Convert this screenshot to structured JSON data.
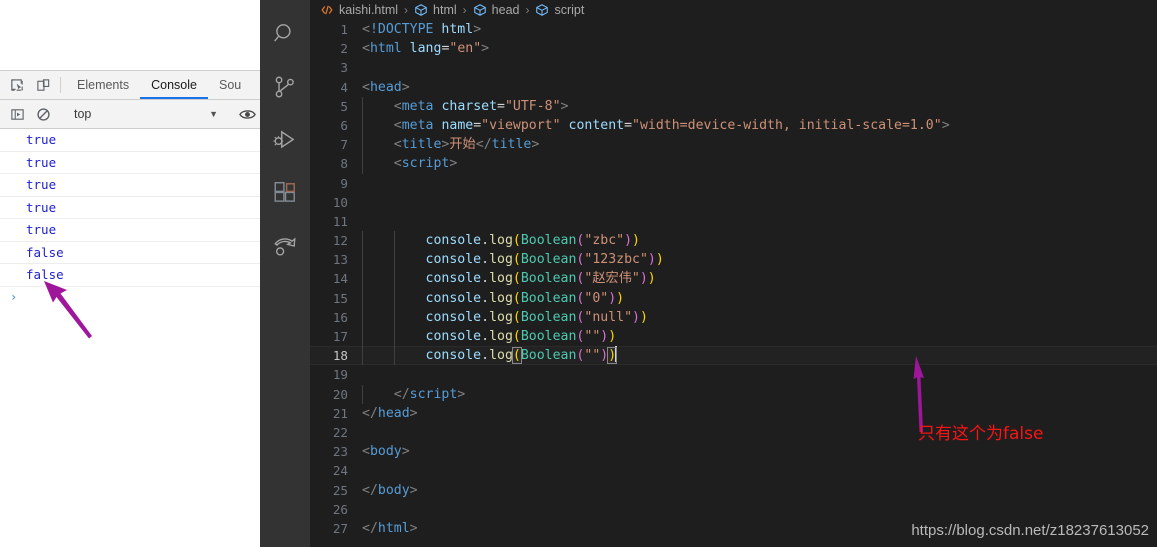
{
  "devtools": {
    "toolbar_icons": [
      {
        "name": "inspect-element-icon",
        "label": "Inspect"
      },
      {
        "name": "device-toolbar-icon",
        "label": "Toggle device toolbar"
      }
    ],
    "tabs": [
      {
        "label": "Elements",
        "active": false
      },
      {
        "label": "Console",
        "active": true
      },
      {
        "label": "Sou",
        "active": false
      }
    ],
    "filterbar": {
      "sidebar_toggle_label": "Show console sidebar",
      "clear_console_label": "Clear console",
      "context_value": "top",
      "caret": "▼",
      "eye_label": "Create live expression"
    },
    "console_entries": [
      {
        "value": "true"
      },
      {
        "value": "true"
      },
      {
        "value": "true"
      },
      {
        "value": "true"
      },
      {
        "value": "true"
      },
      {
        "value": "false"
      },
      {
        "value": "false"
      }
    ],
    "prompt_symbol": "›"
  },
  "activitybar": {
    "items": [
      {
        "name": "search-icon",
        "label": "Search"
      },
      {
        "name": "source-control-icon",
        "label": "Source Control"
      },
      {
        "name": "run-and-debug-icon",
        "label": "Run and Debug"
      },
      {
        "name": "extensions-icon",
        "label": "Extensions"
      },
      {
        "name": "remote-explorer-icon",
        "label": "Remote Explorer"
      }
    ]
  },
  "breadcrumb": {
    "separator": "›",
    "items": [
      {
        "label": "kaishi.html",
        "icon": "html-file-icon"
      },
      {
        "label": "html",
        "icon": "symbol-field-icon"
      },
      {
        "label": "head",
        "icon": "symbol-field-icon"
      },
      {
        "label": "script",
        "icon": "symbol-field-icon"
      }
    ]
  },
  "editor": {
    "active_line": 18,
    "lines": [
      {
        "n": 1,
        "tokens": [
          {
            "t": "tagb",
            "v": "<"
          },
          {
            "t": "tag",
            "v": "!DOCTYPE "
          },
          {
            "t": "attr",
            "v": "html"
          },
          {
            "t": "tagb",
            "v": ">"
          }
        ]
      },
      {
        "n": 2,
        "tokens": [
          {
            "t": "tagb",
            "v": "<"
          },
          {
            "t": "tag",
            "v": "html"
          },
          {
            "t": "plain",
            "v": " "
          },
          {
            "t": "attr",
            "v": "lang"
          },
          {
            "t": "eq",
            "v": "="
          },
          {
            "t": "str",
            "v": "\"en\""
          },
          {
            "t": "tagb",
            "v": ">"
          }
        ]
      },
      {
        "n": 3,
        "tokens": []
      },
      {
        "n": 4,
        "tokens": [
          {
            "t": "tagb",
            "v": "<"
          },
          {
            "t": "tag",
            "v": "head"
          },
          {
            "t": "tagb",
            "v": ">"
          }
        ]
      },
      {
        "n": 5,
        "tokens": [
          {
            "t": "plain",
            "v": "    "
          },
          {
            "t": "tagb",
            "v": "<"
          },
          {
            "t": "tag",
            "v": "meta"
          },
          {
            "t": "plain",
            "v": " "
          },
          {
            "t": "attr",
            "v": "charset"
          },
          {
            "t": "eq",
            "v": "="
          },
          {
            "t": "str",
            "v": "\"UTF-8\""
          },
          {
            "t": "tagb",
            "v": ">"
          }
        ]
      },
      {
        "n": 6,
        "tokens": [
          {
            "t": "plain",
            "v": "    "
          },
          {
            "t": "tagb",
            "v": "<"
          },
          {
            "t": "tag",
            "v": "meta"
          },
          {
            "t": "plain",
            "v": " "
          },
          {
            "t": "attr",
            "v": "name"
          },
          {
            "t": "eq",
            "v": "="
          },
          {
            "t": "str",
            "v": "\"viewport\""
          },
          {
            "t": "plain",
            "v": " "
          },
          {
            "t": "attr",
            "v": "content"
          },
          {
            "t": "eq",
            "v": "="
          },
          {
            "t": "str",
            "v": "\"width=device-width, initial-scale=1.0\""
          },
          {
            "t": "tagb",
            "v": ">"
          }
        ]
      },
      {
        "n": 7,
        "tokens": [
          {
            "t": "plain",
            "v": "    "
          },
          {
            "t": "tagb",
            "v": "<"
          },
          {
            "t": "tag",
            "v": "title"
          },
          {
            "t": "tagb",
            "v": ">"
          },
          {
            "t": "cjk",
            "v": "开始"
          },
          {
            "t": "tagb",
            "v": "</"
          },
          {
            "t": "tag",
            "v": "title"
          },
          {
            "t": "tagb",
            "v": ">"
          }
        ]
      },
      {
        "n": 8,
        "tokens": [
          {
            "t": "plain",
            "v": "    "
          },
          {
            "t": "tagb",
            "v": "<"
          },
          {
            "t": "tag",
            "v": "script"
          },
          {
            "t": "tagb",
            "v": ">"
          }
        ]
      },
      {
        "n": 9,
        "tokens": []
      },
      {
        "n": 10,
        "tokens": []
      },
      {
        "n": 11,
        "tokens": []
      },
      {
        "n": 12,
        "tokens": [
          {
            "t": "plain",
            "v": "        "
          },
          {
            "t": "obj",
            "v": "console"
          },
          {
            "t": "plain",
            "v": "."
          },
          {
            "t": "fn",
            "v": "log"
          },
          {
            "t": "p1",
            "v": "("
          },
          {
            "t": "class",
            "v": "Boolean"
          },
          {
            "t": "p2",
            "v": "("
          },
          {
            "t": "str",
            "v": "\"zbc\""
          },
          {
            "t": "p2",
            "v": ")"
          },
          {
            "t": "p1",
            "v": ")"
          }
        ]
      },
      {
        "n": 13,
        "tokens": [
          {
            "t": "plain",
            "v": "        "
          },
          {
            "t": "obj",
            "v": "console"
          },
          {
            "t": "plain",
            "v": "."
          },
          {
            "t": "fn",
            "v": "log"
          },
          {
            "t": "p1",
            "v": "("
          },
          {
            "t": "class",
            "v": "Boolean"
          },
          {
            "t": "p2",
            "v": "("
          },
          {
            "t": "str",
            "v": "\"123zbc\""
          },
          {
            "t": "p2",
            "v": ")"
          },
          {
            "t": "p1",
            "v": ")"
          }
        ]
      },
      {
        "n": 14,
        "tokens": [
          {
            "t": "plain",
            "v": "        "
          },
          {
            "t": "obj",
            "v": "console"
          },
          {
            "t": "plain",
            "v": "."
          },
          {
            "t": "fn",
            "v": "log"
          },
          {
            "t": "p1",
            "v": "("
          },
          {
            "t": "class",
            "v": "Boolean"
          },
          {
            "t": "p2",
            "v": "("
          },
          {
            "t": "str",
            "v": "\"赵宏伟\""
          },
          {
            "t": "p2",
            "v": ")"
          },
          {
            "t": "p1",
            "v": ")"
          }
        ]
      },
      {
        "n": 15,
        "tokens": [
          {
            "t": "plain",
            "v": "        "
          },
          {
            "t": "obj",
            "v": "console"
          },
          {
            "t": "plain",
            "v": "."
          },
          {
            "t": "fn",
            "v": "log"
          },
          {
            "t": "p1",
            "v": "("
          },
          {
            "t": "class",
            "v": "Boolean"
          },
          {
            "t": "p2",
            "v": "("
          },
          {
            "t": "str",
            "v": "\"0\""
          },
          {
            "t": "p2",
            "v": ")"
          },
          {
            "t": "p1",
            "v": ")"
          }
        ]
      },
      {
        "n": 16,
        "tokens": [
          {
            "t": "plain",
            "v": "        "
          },
          {
            "t": "obj",
            "v": "console"
          },
          {
            "t": "plain",
            "v": "."
          },
          {
            "t": "fn",
            "v": "log"
          },
          {
            "t": "p1",
            "v": "("
          },
          {
            "t": "class",
            "v": "Boolean"
          },
          {
            "t": "p2",
            "v": "("
          },
          {
            "t": "str",
            "v": "\"null\""
          },
          {
            "t": "p2",
            "v": ")"
          },
          {
            "t": "p1",
            "v": ")"
          }
        ]
      },
      {
        "n": 17,
        "tokens": [
          {
            "t": "plain",
            "v": "        "
          },
          {
            "t": "obj",
            "v": "console"
          },
          {
            "t": "plain",
            "v": "."
          },
          {
            "t": "fn",
            "v": "log"
          },
          {
            "t": "p1",
            "v": "("
          },
          {
            "t": "class",
            "v": "Boolean"
          },
          {
            "t": "p2",
            "v": "("
          },
          {
            "t": "str",
            "v": "\"\""
          },
          {
            "t": "p2",
            "v": ")"
          },
          {
            "t": "p1",
            "v": ")"
          }
        ]
      },
      {
        "n": 18,
        "tokens": [
          {
            "t": "plain",
            "v": "        "
          },
          {
            "t": "obj",
            "v": "console"
          },
          {
            "t": "plain",
            "v": "."
          },
          {
            "t": "fn",
            "v": "log"
          },
          {
            "t": "p1 bracket-match",
            "v": "("
          },
          {
            "t": "class",
            "v": "Boolean"
          },
          {
            "t": "p2",
            "v": "("
          },
          {
            "t": "str",
            "v": "\"\""
          },
          {
            "t": "p2",
            "v": ")"
          },
          {
            "t": "p1 bracket-match",
            "v": ")"
          },
          {
            "t": "cursor",
            "v": ""
          }
        ]
      },
      {
        "n": 19,
        "tokens": []
      },
      {
        "n": 20,
        "tokens": [
          {
            "t": "plain",
            "v": "    "
          },
          {
            "t": "tagb",
            "v": "</"
          },
          {
            "t": "tag",
            "v": "script"
          },
          {
            "t": "tagb",
            "v": ">"
          }
        ]
      },
      {
        "n": 21,
        "tokens": [
          {
            "t": "tagb",
            "v": "</"
          },
          {
            "t": "tag",
            "v": "head"
          },
          {
            "t": "tagb",
            "v": ">"
          }
        ]
      },
      {
        "n": 22,
        "tokens": []
      },
      {
        "n": 23,
        "tokens": [
          {
            "t": "tagb",
            "v": "<"
          },
          {
            "t": "tag",
            "v": "body"
          },
          {
            "t": "tagb",
            "v": ">"
          }
        ]
      },
      {
        "n": 24,
        "tokens": []
      },
      {
        "n": 25,
        "tokens": [
          {
            "t": "tagb",
            "v": "</"
          },
          {
            "t": "tag",
            "v": "body"
          },
          {
            "t": "tagb",
            "v": ">"
          }
        ]
      },
      {
        "n": 26,
        "tokens": []
      },
      {
        "n": 27,
        "tokens": [
          {
            "t": "tagb",
            "v": "</"
          },
          {
            "t": "tag",
            "v": "html"
          },
          {
            "t": "tagb",
            "v": ">"
          }
        ]
      }
    ]
  },
  "annotations": {
    "note_text": "只有这个为false",
    "note_color": "#fa1414",
    "arrow_color": "#a0169b",
    "watermark": "https://blog.csdn.net/z18237613052"
  }
}
